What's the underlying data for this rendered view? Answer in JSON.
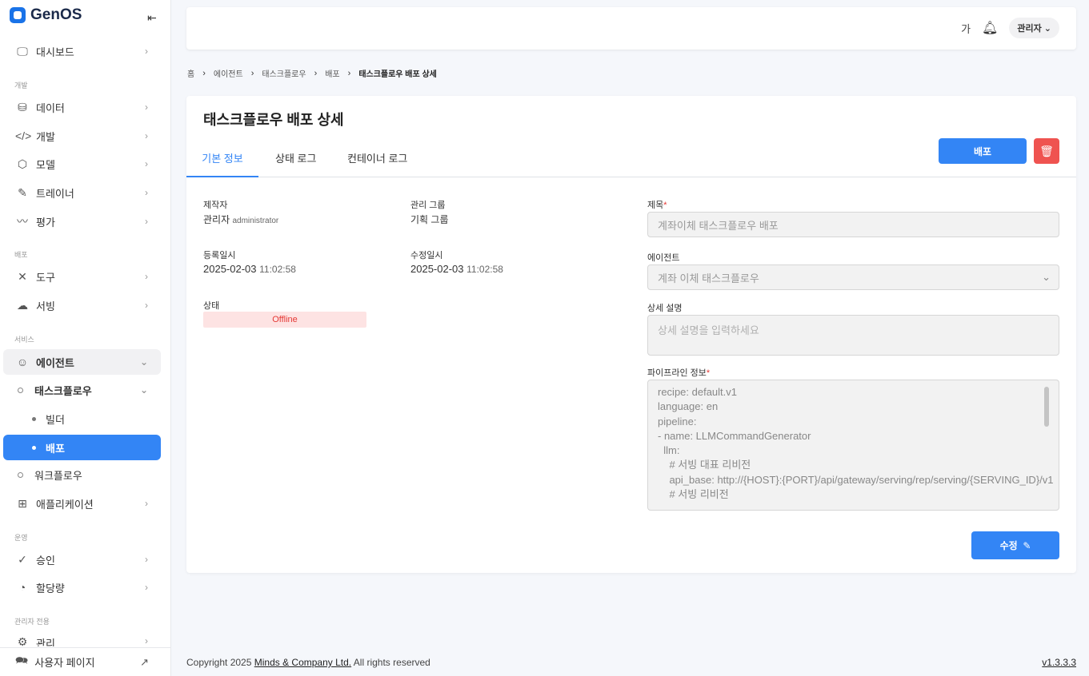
{
  "brand": {
    "name": "GenOS"
  },
  "sidebar": {
    "items": [
      {
        "label": "대시보드",
        "icon": "monitor-icon"
      },
      {
        "section": "개발"
      },
      {
        "label": "데이터",
        "icon": "database-icon"
      },
      {
        "label": "개발",
        "icon": "code-icon"
      },
      {
        "label": "모델",
        "icon": "cube-icon"
      },
      {
        "label": "트레이너",
        "icon": "pencil-icon"
      },
      {
        "label": "평가",
        "icon": "trend-icon"
      },
      {
        "section": "배포"
      },
      {
        "label": "도구",
        "icon": "tools-icon"
      },
      {
        "label": "서빙",
        "icon": "cloud-icon"
      },
      {
        "section": "서비스"
      },
      {
        "label": "에이전트",
        "icon": "robot-icon"
      },
      {
        "label": "태스크플로우"
      },
      {
        "label": "빌더"
      },
      {
        "label": "배포"
      },
      {
        "label": "워크플로우"
      },
      {
        "label": "애플리케이션",
        "icon": "apps-icon"
      },
      {
        "section": "운영"
      },
      {
        "label": "승인",
        "icon": "check-icon"
      },
      {
        "label": "할당량",
        "icon": "pie-icon"
      },
      {
        "section": "관리자 전용"
      },
      {
        "label": "관리",
        "icon": "gear-icon"
      }
    ],
    "user_page": "사용자 페이지"
  },
  "header": {
    "lang": "가",
    "user": "관리자"
  },
  "breadcrumb": [
    "홈",
    "에이전트",
    "태스크플로우",
    "배포",
    "태스크플로우 배포 상세"
  ],
  "page": {
    "title": "태스크플로우 배포 상세",
    "tabs": [
      "기본 정보",
      "상태 로그",
      "컨테이너 로그"
    ],
    "deploy_label": "배포",
    "edit_label": "수정",
    "info": {
      "creator_label": "제작자",
      "creator": "관리자",
      "creator_id": "administrator",
      "group_label": "관리 그룹",
      "group": "기획 그룹",
      "created_label": "등록일시",
      "created_date": "2025-02-03",
      "created_time": "11:02:58",
      "updated_label": "수정일시",
      "updated_date": "2025-02-03",
      "updated_time": "11:02:58",
      "status_label": "상태",
      "status": "Offline"
    },
    "form": {
      "title_label": "제목",
      "title_value": "계좌이체 태스크플로우 배포",
      "agent_label": "에이전트",
      "agent_value": "계좌 이체 태스크플로우",
      "desc_label": "상세 설명",
      "desc_placeholder": "상세 설명을 입력하세요",
      "pipeline_label": "파이프라인 정보",
      "pipeline_lines": [
        "recipe: default.v1",
        "language: en",
        "pipeline:",
        "- name: LLMCommandGenerator",
        "  llm:",
        "    # 서빙 대표 리비전",
        "    api_base: http://{HOST}:{PORT}/api/gateway/serving/rep/serving/{SERVING_ID}/v1",
        "    # 서빙 리비전"
      ]
    }
  },
  "footer": {
    "prefix": "Copyright 2025 ",
    "company": "Minds & Company Ltd.",
    "suffix": " All rights reserved",
    "version": "v1.3.3.3"
  },
  "colors": {
    "accent": "#3385f5",
    "danger": "#ef5350"
  }
}
